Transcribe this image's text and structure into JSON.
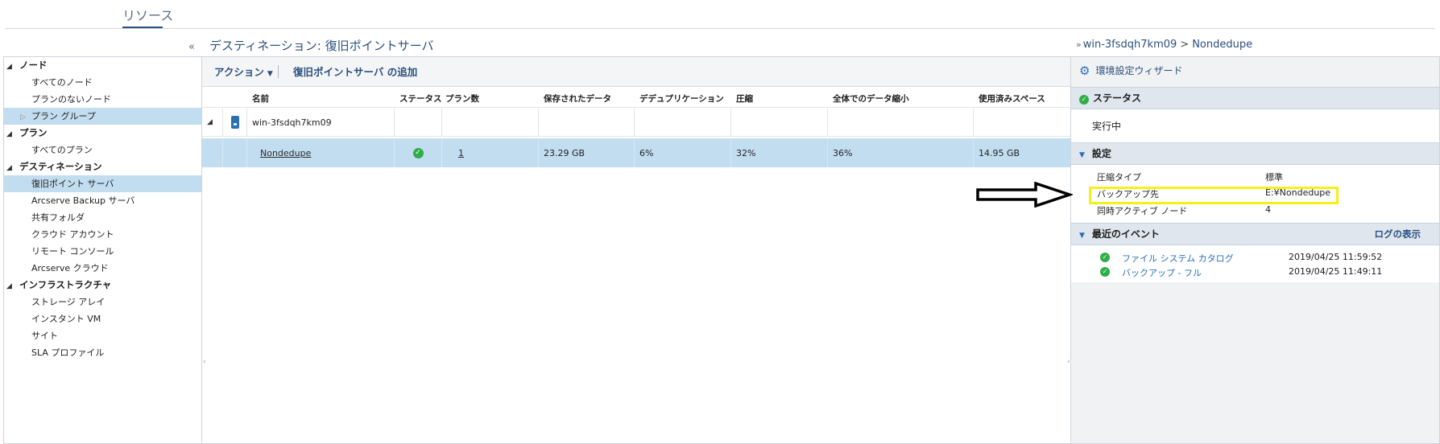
{
  "top_tab": {
    "label": "リソース"
  },
  "header": {
    "collapse_icon": "double-chevron-left-icon",
    "title": "デスティネーション: 復旧ポイントサーバ",
    "breadcrumb": {
      "server": "win-3fsdqh7km09",
      "separator": ">",
      "node": "Nondedupe"
    }
  },
  "tree": {
    "groups": [
      {
        "label": "ノード",
        "items": [
          "すべてのノード",
          "プランのないノード",
          "プラン グループ"
        ]
      },
      {
        "label": "プラン",
        "items": [
          "すべてのプラン"
        ]
      },
      {
        "label": "デスティネーション",
        "items": [
          "復旧ポイント サーバ",
          "Arcserve Backup サーバ",
          "共有フォルダ",
          "クラウド アカウント",
          "リモート コンソール",
          "Arcserve クラウド"
        ]
      },
      {
        "label": "インフラストラクチャ",
        "items": [
          "ストレージ アレイ",
          "インスタント VM",
          "サイト",
          "SLA プロファイル"
        ]
      }
    ],
    "selected": "復旧ポイント サーバ",
    "collapsed_item": "プラン グループ"
  },
  "toolbar": {
    "action_label": "アクション",
    "add_label": "復旧ポイントサーバ の追加"
  },
  "grid": {
    "columns": [
      "名前",
      "ステータス",
      "プラン数",
      "保存されたデータ",
      "デデュプリケーション",
      "圧縮",
      "全体でのデータ縮小",
      "使用済みスペース"
    ],
    "group_row": {
      "name": "win-3fsdqh7km09"
    },
    "rows": [
      {
        "name": "Nondedupe",
        "status": "ok",
        "plans": "1",
        "saved_data": "23.29 GB",
        "dedup": "6%",
        "compression": "32%",
        "overall_reduction": "36%",
        "used_space": "14.95 GB"
      }
    ]
  },
  "right": {
    "wizard_label": "環境設定ウィザード",
    "status": {
      "title": "ステータス",
      "value": "実行中"
    },
    "settings": {
      "title": "設定",
      "items": [
        {
          "label": "圧縮タイプ",
          "value": "標準"
        },
        {
          "label": "バックアップ先",
          "value": "E:¥Nondedupe"
        },
        {
          "label": "同時アクティブ ノード",
          "value": "4"
        }
      ]
    },
    "events": {
      "title": "最近のイベント",
      "log_link": "ログの表示",
      "items": [
        {
          "name": "ファイル システム カタログ",
          "time": "2019/04/25 11:59:52"
        },
        {
          "name": "バックアップ - フル",
          "time": "2019/04/25 11:49:11"
        }
      ]
    }
  },
  "colors": {
    "accent": "#2b4f7e",
    "selection": "#c2ddf0",
    "ok": "#2fae47",
    "highlight": "#f6f01a"
  }
}
